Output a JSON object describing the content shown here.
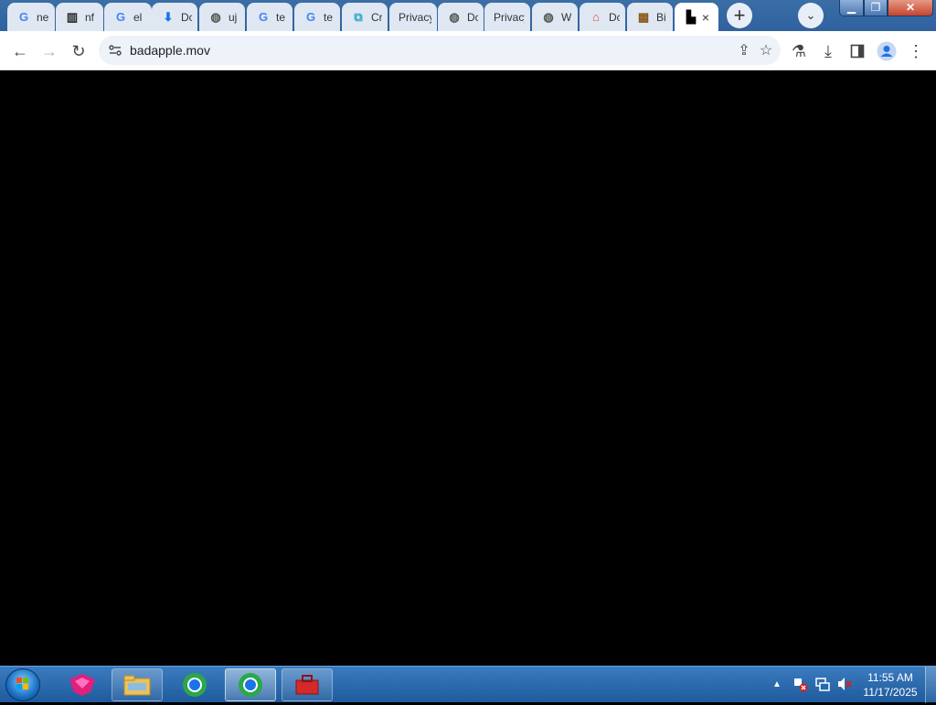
{
  "browser": {
    "tabs": [
      {
        "title": "ne",
        "icon": "google-g-icon",
        "glyph": "G",
        "color": "#4285f4"
      },
      {
        "title": "nf",
        "icon": "bank-icon",
        "glyph": "▥",
        "color": "#222222"
      },
      {
        "title": "el",
        "icon": "google-g-icon",
        "glyph": "G",
        "color": "#4285f4"
      },
      {
        "title": "Dc",
        "icon": "download-icon",
        "glyph": "⬇",
        "color": "#1a73e8"
      },
      {
        "title": "uj",
        "icon": "globe-icon",
        "glyph": "◍",
        "color": "#555555"
      },
      {
        "title": "te",
        "icon": "google-g-icon",
        "glyph": "G",
        "color": "#4285f4"
      },
      {
        "title": "te",
        "icon": "google-g-icon",
        "glyph": "G",
        "color": "#4285f4"
      },
      {
        "title": "Cr",
        "icon": "extension-icon",
        "glyph": "⧉",
        "color": "#2aa7c9"
      },
      {
        "title": "Privacy",
        "icon": "",
        "glyph": "",
        "color": "#333333"
      },
      {
        "title": "Dc",
        "icon": "globe-icon",
        "glyph": "◍",
        "color": "#555555"
      },
      {
        "title": "Privacy",
        "icon": "",
        "glyph": "",
        "color": "#333333"
      },
      {
        "title": "W",
        "icon": "globe-icon",
        "glyph": "◍",
        "color": "#555555"
      },
      {
        "title": "Dc",
        "icon": "store-icon",
        "glyph": "⌂",
        "color": "#e0443a"
      },
      {
        "title": "Bi",
        "icon": "image-icon",
        "glyph": "▩",
        "color": "#8a5a1c"
      },
      {
        "title": "",
        "icon": "file-icon",
        "glyph": "▙",
        "color": "#000000",
        "active": true
      }
    ],
    "active_tab_close": "×",
    "new_tab_glyph": "+",
    "tab_search_glyph": "⌄",
    "window_controls": {
      "minimize": "▁",
      "maximize": "❐",
      "close": "✕"
    },
    "toolbar": {
      "back": "←",
      "forward": "→",
      "reload": "↻",
      "url": "badapple.mov",
      "share": "⇪",
      "bookmark": "☆",
      "labs": "⚗",
      "downloads": "⤓",
      "sidepanel": "▮",
      "menu": "⋮"
    }
  },
  "taskbar": {
    "clock_time": "11:55 AM",
    "clock_date": "11/17/2025",
    "tray_arrow": "▲",
    "accent": "#2468b0"
  }
}
